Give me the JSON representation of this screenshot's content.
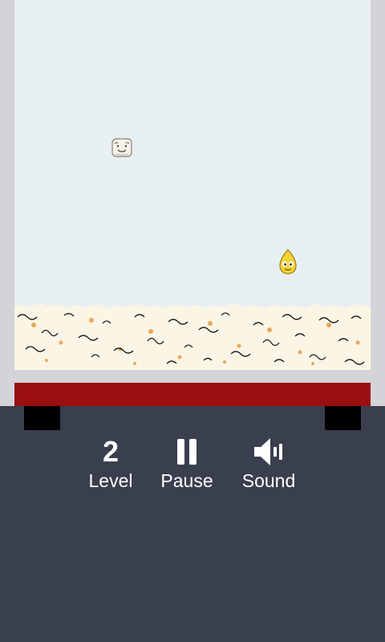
{
  "game": {
    "characters": [
      "marshmallow-icon",
      "popcorn-kernel-icon"
    ],
    "colors": {
      "play_field": "#e8eff3",
      "frame": "#d4d3d8",
      "red_bar": "#990f12",
      "panel": "#3a3f4e"
    }
  },
  "controls": {
    "level_value": "2",
    "level_label": "Level",
    "pause_label": "Pause",
    "sound_label": "Sound"
  }
}
